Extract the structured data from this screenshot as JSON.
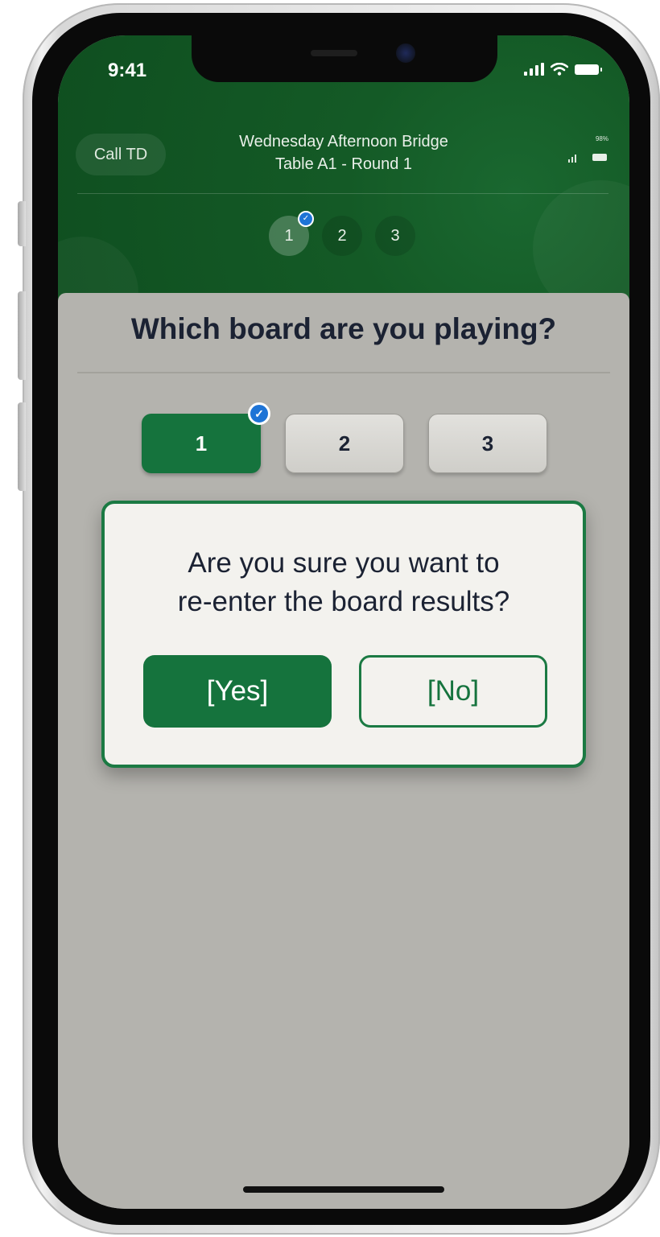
{
  "status_bar": {
    "time": "9:41"
  },
  "header": {
    "call_td_label": "Call TD",
    "event_name": "Wednesday Afternoon Bridge",
    "table_round": "Table A1  -  Round 1",
    "mini_battery_pct": "98%",
    "steps": [
      "1",
      "2",
      "3"
    ],
    "active_step": "1"
  },
  "main": {
    "question": "Which board are you playing?",
    "boards": [
      "1",
      "2",
      "3"
    ],
    "selected_board": "1"
  },
  "dialog": {
    "message_line1": "Are you sure you want to",
    "message_line2": "re-enter the board results?",
    "yes_label": "[Yes]",
    "no_label": "[No]"
  },
  "colors": {
    "header_green": "#145a26",
    "accent_green": "#15733d",
    "check_blue": "#1e74d6",
    "sheet_gray": "#b4b3ae",
    "dialog_bg": "#f3f2ee",
    "text_dark": "#1b2233"
  },
  "icons": {
    "signal": "signal-icon",
    "wifi": "wifi-icon",
    "battery": "battery-icon",
    "check": "check-badge-icon"
  }
}
